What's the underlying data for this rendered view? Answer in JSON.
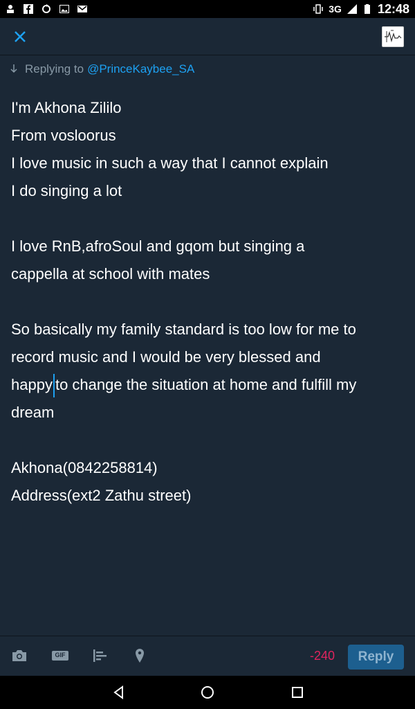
{
  "status_bar": {
    "network": "3G",
    "time": "12:48"
  },
  "reply_context": {
    "prefix": "Replying to",
    "handle": "@PrinceKaybee_SA"
  },
  "tweet_lines": [
    "I'm Akhona Zililo",
    "From vosloorus",
    "I love music in such a way that I cannot explain",
    "I do singing a lot",
    "",
    "I love RnB,afroSoul and gqom but singing a",
    "cappella at school with mates",
    "",
    "So basically my family standard is too low for me to",
    "record music and I would be very blessed and",
    "happy|to change the situation at home and fulfill my",
    "dream",
    "",
    "Akhona(0842258814)",
    "Address(ext2 Zathu street)"
  ],
  "toolbar": {
    "gif_label": "GIF",
    "char_counter": "-240",
    "reply_label": "Reply"
  },
  "colors": {
    "background": "#1b2836",
    "accent": "#1da1f2",
    "counter_over_limit": "#e0245e"
  }
}
